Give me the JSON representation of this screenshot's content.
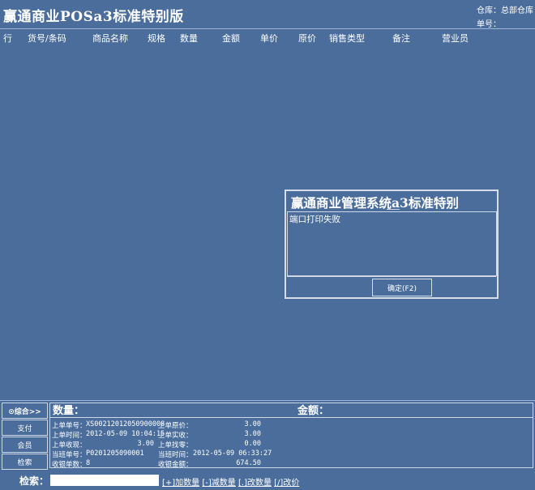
{
  "app": {
    "title": "赢通商业POSa3标准特别版",
    "warehouse": "仓库：总部仓库",
    "order_no": "单号："
  },
  "columns": [
    "行",
    "货号/条码",
    "商品名称",
    "规格",
    "数量",
    "金额",
    "单价",
    "原价",
    "销售类型",
    "备注",
    "营业员"
  ],
  "dialog": {
    "title": "赢通商业管理系统a3标准特别",
    "message": "端口打印失败",
    "ok_label": "确定(F2)"
  },
  "left_buttons": {
    "combined": "⊙综合>>",
    "pay": "支付",
    "member": "会员",
    "search": "检索"
  },
  "summary": {
    "qty_label": "数量：",
    "amount_label": "金额："
  },
  "details": {
    "last_no_label": "上单单号：",
    "last_no": "XS00212012050900008",
    "last_time_label": "上单时间：",
    "last_time": "2012-05-09 10:04:15",
    "last_receipt_label": "上单收现：",
    "last_receipt": "3.00",
    "shift_no_label": "当班单号：",
    "shift_no": "P0201205090001",
    "cashier_count_label": "收银单数：",
    "cashier_count": "8",
    "last_orig_label": "上单原价：",
    "last_orig": "3.00",
    "last_actual_label": "上单实收：",
    "last_actual": "3.00",
    "last_change_label": "上单找零：",
    "last_change": "0.00",
    "shift_time_label": "当班时间：",
    "shift_time": "2012-05-09 06:33:27",
    "cashier_amount_label": "收银金额：",
    "cashier_amount": "674.50"
  },
  "search": {
    "label": "检索：",
    "value": "",
    "hints": [
      "[+]加数量",
      "[-]减数量",
      "[.]改数量",
      "[/]改价"
    ]
  }
}
